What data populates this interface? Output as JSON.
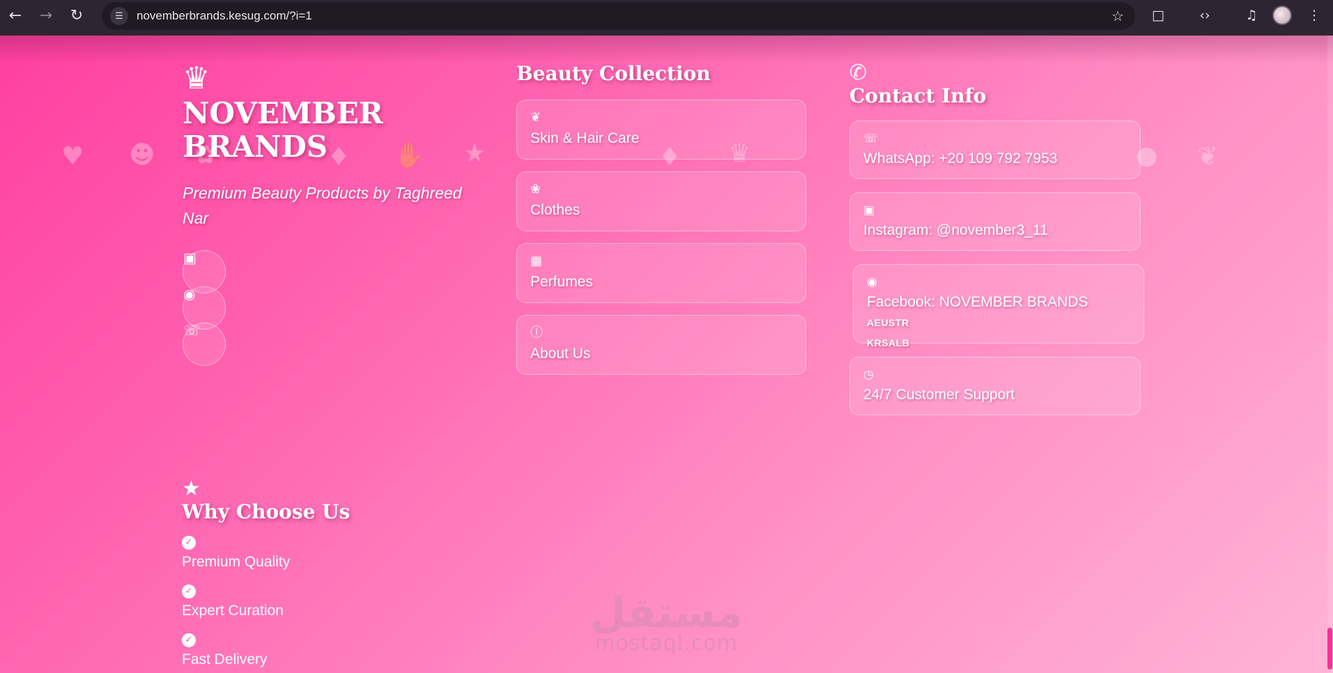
{
  "browser": {
    "url": "novemberbrands.kesug.com/?i=1",
    "icons": {
      "back": "arrow-left-icon",
      "forward": "arrow-right-icon",
      "reload": "reload-icon",
      "site_info": "tune-icon",
      "bookmark": "star-icon",
      "extensions": "puzzle-icon",
      "devtools": "code-icon",
      "media": "playlist-icon",
      "profile": "avatar",
      "menu": "kebab-icon"
    }
  },
  "brand": {
    "name_line1": "NOVEMBER",
    "name_line2": "BRANDS",
    "tagline": "Premium Beauty Products by Taghreed Nar",
    "icon": "crown-icon",
    "socials": [
      {
        "name": "instagram",
        "icon": "instagram-icon"
      },
      {
        "name": "facebook",
        "icon": "facebook-icon"
      },
      {
        "name": "whatsapp",
        "icon": "whatsapp-icon"
      }
    ]
  },
  "collection": {
    "heading": "Beauty Collection",
    "items": [
      {
        "label": "Skin & Hair Care",
        "icon": "leaf-icon"
      },
      {
        "label": "Clothes",
        "icon": "lotus-icon"
      },
      {
        "label": "Perfumes",
        "icon": "spray-bottle-icon"
      },
      {
        "label": "About Us",
        "icon": "info-icon"
      }
    ]
  },
  "contact": {
    "heading": "Contact Info",
    "icon": "phone-icon",
    "items": [
      {
        "label": "WhatsApp: +20 109 792 7953",
        "icon": "whatsapp-icon"
      },
      {
        "label": "Instagram: @november3_11",
        "icon": "instagram-icon"
      },
      {
        "label": "Facebook: NOVEMBER BRANDS",
        "suffix1": "AEUSTR",
        "suffix2": "KRSALB",
        "icon": "facebook-icon"
      },
      {
        "label": "24/7 Customer Support",
        "icon": "clock-icon"
      }
    ]
  },
  "why": {
    "heading": "Why Choose Us",
    "icon": "star-icon",
    "items": [
      {
        "label": "Premium Quality"
      },
      {
        "label": "Expert Curation"
      },
      {
        "label": "Fast Delivery"
      }
    ]
  },
  "watermark": {
    "arabic": "مستقل",
    "latin": "mostaql.com"
  },
  "colors": {
    "gradient_start": "#ff3fa0",
    "gradient_end": "#ffb3d6",
    "scroll_thumb": "#ff2f93"
  }
}
